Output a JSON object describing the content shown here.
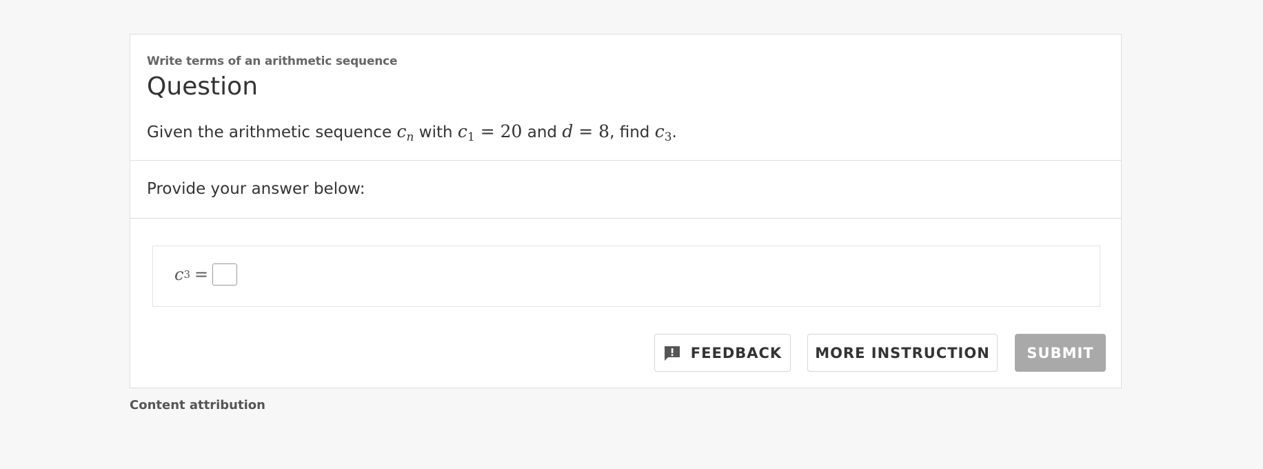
{
  "topic": "Write terms of an arithmetic sequence",
  "title": "Question",
  "question": {
    "t1": "Given the arithmetic sequence ",
    "m1_var": "c",
    "m1_sub": "n",
    "t2": " with ",
    "m2": "c",
    "m2_sub": "1",
    "m2_rest": " = 20",
    "t3": " and ",
    "m3_var": "d",
    "m3_rest": " = 8",
    "t4": ", find ",
    "m4_var": "c",
    "m4_sub": "3",
    "t5": "."
  },
  "prompt": "Provide your answer below:",
  "answer": {
    "var": "c",
    "sub": "3",
    "eq": "=",
    "value": "",
    "placeholder": ""
  },
  "buttons": {
    "feedback": "FEEDBACK",
    "more_instruction": "MORE INSTRUCTION",
    "submit": "SUBMIT"
  },
  "footer": {
    "attribution": "Content attribution"
  },
  "icons": {
    "feedback": "feedback-icon"
  },
  "colors": {
    "background": "#f7f7f7",
    "submit_disabled": "#a9a9a9",
    "text": "#333333"
  }
}
